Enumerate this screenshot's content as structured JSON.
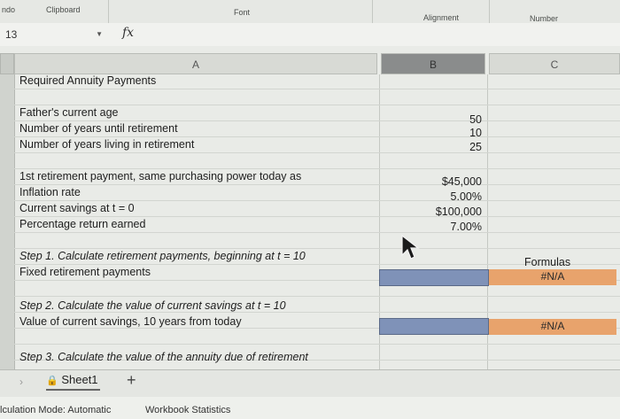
{
  "ribbon": {
    "groups": [
      "ndo",
      "Clipboard",
      "Font",
      "Alignment",
      "Number"
    ]
  },
  "formula_bar": {
    "name_box": "13",
    "fx_label": "fx"
  },
  "columns": {
    "a": "A",
    "b": "B",
    "c": "C"
  },
  "rows": {
    "title": "Required Annuity Payments",
    "father_age_label": "Father's current age",
    "father_age_value": "50",
    "years_until_label": "Number of years until retirement",
    "years_until_value": "10",
    "years_living_label": "Number of years living in retirement",
    "years_living_value": "25",
    "first_payment_label": "1st retirement payment, same purchasing power today as",
    "first_payment_value": "$45,000",
    "inflation_label": "Inflation rate",
    "inflation_value": "5.00%",
    "savings_label": "Current savings at t = 0",
    "savings_value": "$100,000",
    "return_label": "Percentage return earned",
    "return_value": "7.00%",
    "step1": "Step 1. Calculate retirement payments, beginning at t = 10",
    "formulas_header": "Formulas",
    "fixed_payments_label": "Fixed retirement payments",
    "fixed_payments_formula": "#N/A",
    "step2": "Step 2. Calculate the value of current savings at t = 10",
    "current_savings_label": "Value of current savings, 10 years from today",
    "current_savings_formula": "#N/A",
    "step3": "Step 3. Calculate the value of the annuity due of retirement"
  },
  "sheet_tabs": {
    "nav": "›",
    "active": "Sheet1",
    "add": "+"
  },
  "status_bar": {
    "calc_mode": "lculation Mode: Automatic",
    "workbook_stats": "Workbook Statistics"
  },
  "colors": {
    "selection_blue": "#7f92b8",
    "formula_orange": "#e8a36c"
  }
}
